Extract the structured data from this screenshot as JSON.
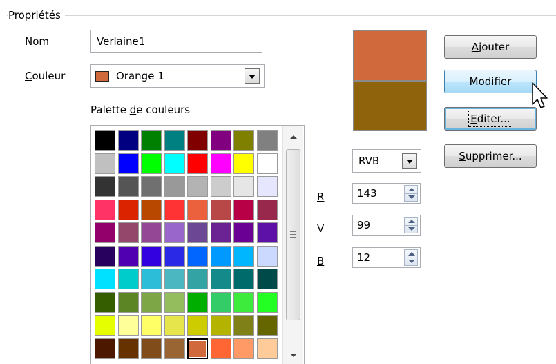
{
  "group": {
    "title": "Propriétés"
  },
  "name_field": {
    "label": "Nom",
    "mnemonic": "N",
    "rest": "om",
    "value": "Verlaine1"
  },
  "color_field": {
    "label": "Couleur",
    "mnemonic": "C",
    "rest": "ouleur",
    "value": "Orange 1",
    "swatch": "#D06A3C"
  },
  "palette": {
    "label_pre": "Palette ",
    "label_mnemonic": "d",
    "label_post": "e couleurs",
    "selected_index": 76,
    "colors": [
      "#000000",
      "#000080",
      "#008000",
      "#008080",
      "#800000",
      "#800080",
      "#808000",
      "#808080",
      "#C0C0C0",
      "#0000FF",
      "#00FF00",
      "#00FFFF",
      "#FF0000",
      "#FF00FF",
      "#FFFF00",
      "#FFFFFF",
      "#333333",
      "#555555",
      "#707070",
      "#999999",
      "#B3B3B3",
      "#CCCCCC",
      "#E6E6E6",
      "#E6E6FF",
      "#FF3366",
      "#DC2300",
      "#B84700",
      "#FF3333",
      "#EB613D",
      "#B84747",
      "#B80047",
      "#99284D",
      "#94006B",
      "#94476B",
      "#944794",
      "#9966CC",
      "#6B4794",
      "#6B2394",
      "#6B0094",
      "#5E11A6",
      "#28005E",
      "#5000B0",
      "#3300E0",
      "#2A2AE6",
      "#0066FF",
      "#0099FF",
      "#00B7FF",
      "#CCD9FF",
      "#00E0FF",
      "#00CCCC",
      "#2CBDD8",
      "#4BB8C1",
      "#33A3A3",
      "#148A8A",
      "#006B6B",
      "#004A4A",
      "#355E00",
      "#5C8526",
      "#7DA647",
      "#94BD5E",
      "#00AE00",
      "#33CC66",
      "#3DEB3D",
      "#23FF23",
      "#E6FF00",
      "#FFFF99",
      "#FFFF66",
      "#E6E64C",
      "#CCCC00",
      "#B3B300",
      "#808019",
      "#666600",
      "#4C1900",
      "#663300",
      "#804C19",
      "#996633",
      "#D06A3C",
      "#FF6633",
      "#FF9966",
      "#FFCC99"
    ]
  },
  "preview": {
    "old_color": "#D06A3C",
    "new_color": "#8F630C"
  },
  "color_model": {
    "value": "RVB"
  },
  "channels": [
    {
      "label": "R",
      "value": "143"
    },
    {
      "label": "V",
      "value": "99"
    },
    {
      "label": "B",
      "value": "12"
    }
  ],
  "buttons": {
    "add": {
      "mnemonic": "A",
      "rest": "jouter"
    },
    "modify": {
      "mnemonic": "M",
      "rest": "odifier"
    },
    "edit": {
      "mnemonic": "E",
      "rest": "diter..."
    },
    "delete": {
      "mnemonic": "S",
      "rest": "upprimer..."
    }
  }
}
